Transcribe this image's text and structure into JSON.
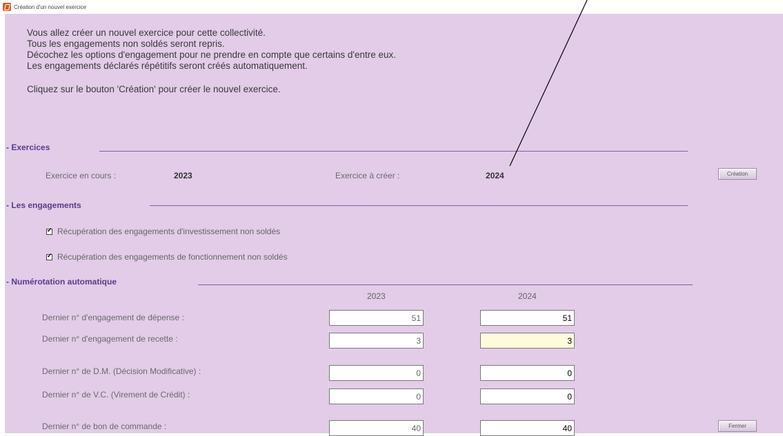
{
  "window": {
    "title": "Création d'un nouvel exercice"
  },
  "intro": {
    "lines": [
      "Vous allez créer un nouvel exercice pour cette collectivité.",
      "Tous les engagements non soldés seront repris.",
      "Décochez les options d'engagement pour ne prendre en compte que certains d'entre eux.",
      "Les engagements déclarés répétitifs seront créés automatiquement."
    ],
    "instruction": "Cliquez sur le bouton 'Création' pour créer le nouvel exercice."
  },
  "exercices": {
    "section_label": "- Exercices",
    "current_label": "Exercice en cours :",
    "current_value": "2023",
    "new_label": "Exercice à créer :",
    "new_value": "2024",
    "create_button": "Création"
  },
  "engagements": {
    "section_label": "- Les engagements",
    "options": [
      {
        "label": "Récupération des engagements d'investissement non soldés",
        "checked": true
      },
      {
        "label": "Récupération des engagements de fonctionnement non soldés",
        "checked": true
      }
    ]
  },
  "numerotation": {
    "section_label": "- Numérotation automatique",
    "columns": [
      "2023",
      "2024"
    ],
    "rows": [
      {
        "label": "Dernier n° d'engagement de dépense :",
        "old": "51",
        "new": "51"
      },
      {
        "label": "Dernier n° d'engagement de recette :",
        "old": "3",
        "new": "3"
      },
      {
        "label": "Dernier n° de D.M. (Décision Modificative) :",
        "old": "0",
        "new": "0"
      },
      {
        "label": "Dernier n° de V.C. (Virement de Crédit) :",
        "old": "0",
        "new": "0"
      },
      {
        "label": "Dernier n° de bon de commande :",
        "old": "40",
        "new": "40"
      }
    ]
  },
  "footer": {
    "close_button": "Fermer"
  }
}
